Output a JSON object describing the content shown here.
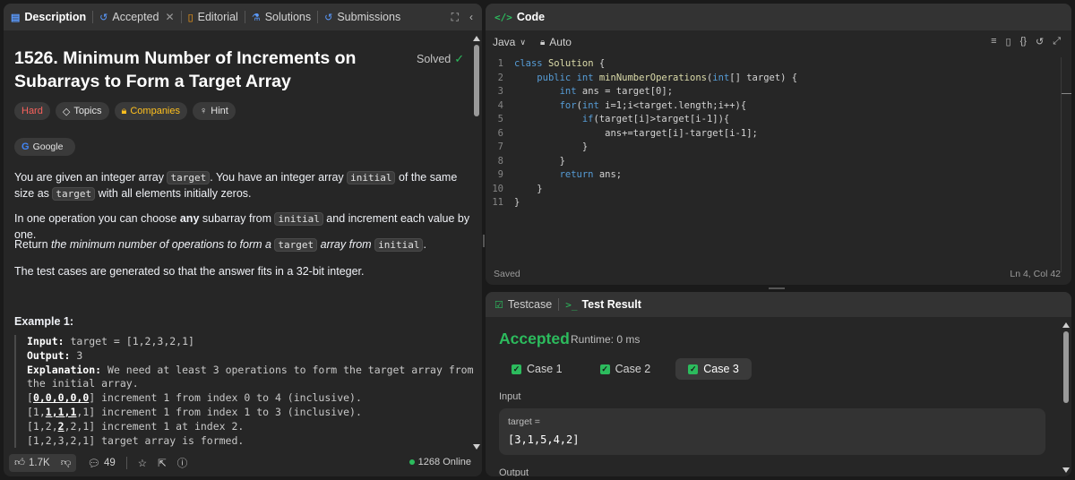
{
  "left_tabs": {
    "description": "Description",
    "accepted": "Accepted",
    "editorial": "Editorial",
    "solutions": "Solutions",
    "submissions": "Submissions"
  },
  "problem": {
    "title": "1526. Minimum Number of Increments on Subarrays to Form a Target Array",
    "status": "Solved",
    "difficulty": "Hard",
    "topics_label": "Topics",
    "companies_label": "Companies",
    "hint_label": "Hint",
    "company": "Google",
    "p1": {
      "t1": "You are given an integer array ",
      "c1": "target",
      "t2": ". You have an integer array ",
      "c2": "initial",
      "t3": " of the same size as ",
      "c3": "target",
      "t4": " with all elements initially zeros."
    },
    "p2": {
      "t1": "In one operation you can choose ",
      "b1": "any",
      "t2": " subarray from ",
      "c1": "initial",
      "t3": " and increment each value by one."
    },
    "p3": {
      "t1": "Return ",
      "i1": "the minimum number of operations to form a ",
      "c1": "target",
      "i2": " array from ",
      "c2": "initial",
      "t2": "."
    },
    "p4": "The test cases are generated so that the answer fits in a 32-bit integer."
  },
  "example": {
    "title": "Example 1:",
    "input_label": "Input:",
    "input_value": " target = [1,2,3,2,1]",
    "output_label": "Output:",
    "output_value": " 3",
    "explanation_label": "Explanation:",
    "explanation_value": " We need at least 3 operations to form the target array from\nthe initial array.",
    "steps": [
      {
        "pre": "[",
        "emph": "0,0,0,0,0",
        "post": "] increment 1 from index 0 to 4 (inclusive)."
      },
      {
        "pre": "[1,",
        "emph": "1,1,1",
        "post": ",1] increment 1 from index 1 to 3 (inclusive)."
      },
      {
        "pre": "[1,2,",
        "emph": "2",
        "post": ",2,1] increment 1 at index 2."
      },
      {
        "pre": "[1,2,3,2,1] target array is formed.",
        "emph": "",
        "post": ""
      }
    ]
  },
  "footer": {
    "likes": "1.7K",
    "comments": "49",
    "online": "1268 Online"
  },
  "code_panel": {
    "title": "Code",
    "language": "Java",
    "mode": "Auto",
    "saved": "Saved",
    "cursor": "Ln 4, Col 42",
    "lines": [
      {
        "n": "1",
        "indent": "",
        "code": "class Solution {"
      },
      {
        "n": "2",
        "indent": "    ",
        "code": "public int minNumberOperations(int[] target) {"
      },
      {
        "n": "3",
        "indent": "        ",
        "code": "int ans = target[0];"
      },
      {
        "n": "4",
        "indent": "        ",
        "code": "for(int i=1;i<target.length;i++){"
      },
      {
        "n": "5",
        "indent": "            ",
        "code": "if(target[i]>target[i-1]){"
      },
      {
        "n": "6",
        "indent": "                ",
        "code": "ans+=target[i]-target[i-1];"
      },
      {
        "n": "7",
        "indent": "            ",
        "code": "}"
      },
      {
        "n": "8",
        "indent": "        ",
        "code": "}"
      },
      {
        "n": "9",
        "indent": "        ",
        "code": "return ans;"
      },
      {
        "n": "10",
        "indent": "    ",
        "code": "}"
      },
      {
        "n": "11",
        "indent": "",
        "code": "}"
      }
    ]
  },
  "test_panel": {
    "testcase_tab": "Testcase",
    "result_tab": "Test Result",
    "verdict": "Accepted",
    "runtime": "Runtime: 0 ms",
    "cases": [
      "Case 1",
      "Case 2",
      "Case 3"
    ],
    "selected_case": 2,
    "input_label": "Input",
    "input_var": "target =",
    "input_value": "[3,1,5,4,2]",
    "output_label": "Output"
  },
  "colors": {
    "accent_green": "#2cbb5d",
    "hard_red": "#f8615c",
    "companies_yellow": "#ffc01e",
    "keyword_blue": "#569cd6"
  }
}
